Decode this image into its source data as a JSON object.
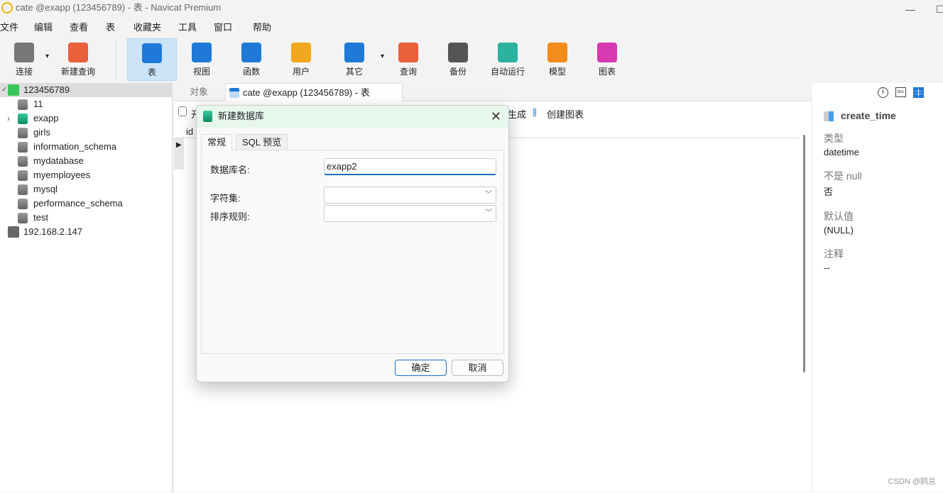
{
  "window": {
    "title": "cate @exapp (123456789) - 表 - Navicat Premium",
    "minimize": "—",
    "maximize": "☐"
  },
  "menu": [
    "文件",
    "编辑",
    "查看",
    "表",
    "收藏夹",
    "工具",
    "窗口",
    "帮助"
  ],
  "toolbar": [
    {
      "label": "连接",
      "icon": "plug-icon",
      "color": "#777"
    },
    {
      "label": "新建查询",
      "icon": "new-query-icon",
      "color": "#e8603c"
    },
    {
      "label": "表",
      "icon": "table-icon",
      "color": "#1e7ad6",
      "active": true
    },
    {
      "label": "视图",
      "icon": "view-icon",
      "color": "#1e7ad6"
    },
    {
      "label": "函数",
      "icon": "function-icon",
      "color": "#1e7ad6"
    },
    {
      "label": "用户",
      "icon": "user-icon",
      "color": "#f2a81d"
    },
    {
      "label": "其它",
      "icon": "tools-icon",
      "color": "#1e7ad6"
    },
    {
      "label": "查询",
      "icon": "query-icon",
      "color": "#e8603c"
    },
    {
      "label": "备份",
      "icon": "backup-icon",
      "color": "#555"
    },
    {
      "label": "自动运行",
      "icon": "robot-icon",
      "color": "#2bb3a0"
    },
    {
      "label": "模型",
      "icon": "model-icon",
      "color": "#f28c1d"
    },
    {
      "label": "图表",
      "icon": "chart-icon",
      "color": "#d63ab0"
    }
  ],
  "tree": {
    "connections": [
      {
        "name": "123456789",
        "expanded": true,
        "databases": [
          {
            "name": "11"
          },
          {
            "name": "exapp",
            "open": true
          },
          {
            "name": "girls"
          },
          {
            "name": "information_schema"
          },
          {
            "name": "mydatabase"
          },
          {
            "name": "myemployees"
          },
          {
            "name": "mysql"
          },
          {
            "name": "performance_schema"
          },
          {
            "name": "test"
          }
        ]
      },
      {
        "name": "192.168.2.147"
      }
    ]
  },
  "tabs": {
    "objects": "对象",
    "active": "cate @exapp (123456789) - 表"
  },
  "subtoolbar": {
    "open_partial": "开",
    "generate": "生成",
    "create_chart": "创建图表"
  },
  "grid": {
    "column": "id"
  },
  "dialog": {
    "title": "新建数据库",
    "tabs": [
      "常规",
      "SQL 预览"
    ],
    "fields": {
      "name_label": "数据库名:",
      "name_value": "exapp2",
      "charset_label": "字符集:",
      "charset_value": "",
      "collation_label": "排序规则:",
      "collation_value": ""
    },
    "ok": "确定",
    "cancel": "取消"
  },
  "right_pane": {
    "field_name": "create_time",
    "props": [
      {
        "label": "类型",
        "value": "datetime"
      },
      {
        "label": "不是 null",
        "value": "否"
      },
      {
        "label": "默认值",
        "value": "(NULL)"
      },
      {
        "label": "注释",
        "value": "--"
      }
    ]
  },
  "watermark": "CSDN @鸥总"
}
